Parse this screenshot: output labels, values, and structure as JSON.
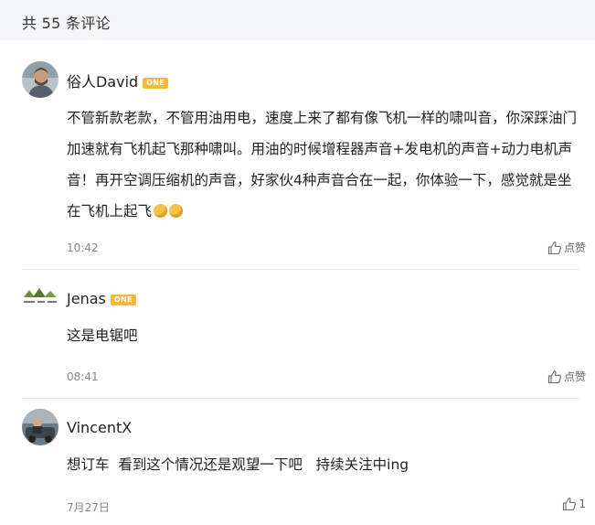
{
  "header": {
    "title": "共 55 条评论"
  },
  "comments": [
    {
      "username": "俗人David",
      "badge": "ONE",
      "text": "不管新款老款，不管用油用电，速度上来了都有像飞机一样的啸叫音，你深踩油门加速就有飞机起飞那种啸叫。用油的时候增程器声音+发电机的声音+动力电机声音！再开空调压缩机的声音，好家伙4种声音合在一起，你体验一下，感觉就是坐在飞机上起飞",
      "time": "10:42",
      "like": "点赞"
    },
    {
      "username": "Jenas",
      "badge": "ONE",
      "text": "这是电锯吧",
      "time": "08:41",
      "like": "点赞"
    },
    {
      "username": "VincentX",
      "text": "想订车  看到这个情况还是观望一下吧   持续关注中ing",
      "time": "7月27日",
      "like": "1"
    }
  ],
  "colors": {
    "badge": "#f6b73c",
    "header_bg": "#f5f6f7",
    "meta_text": "#888888"
  },
  "icons": {
    "like": "thumbs-up-icon",
    "emoji": "laughing-crying-emoji-icon"
  }
}
